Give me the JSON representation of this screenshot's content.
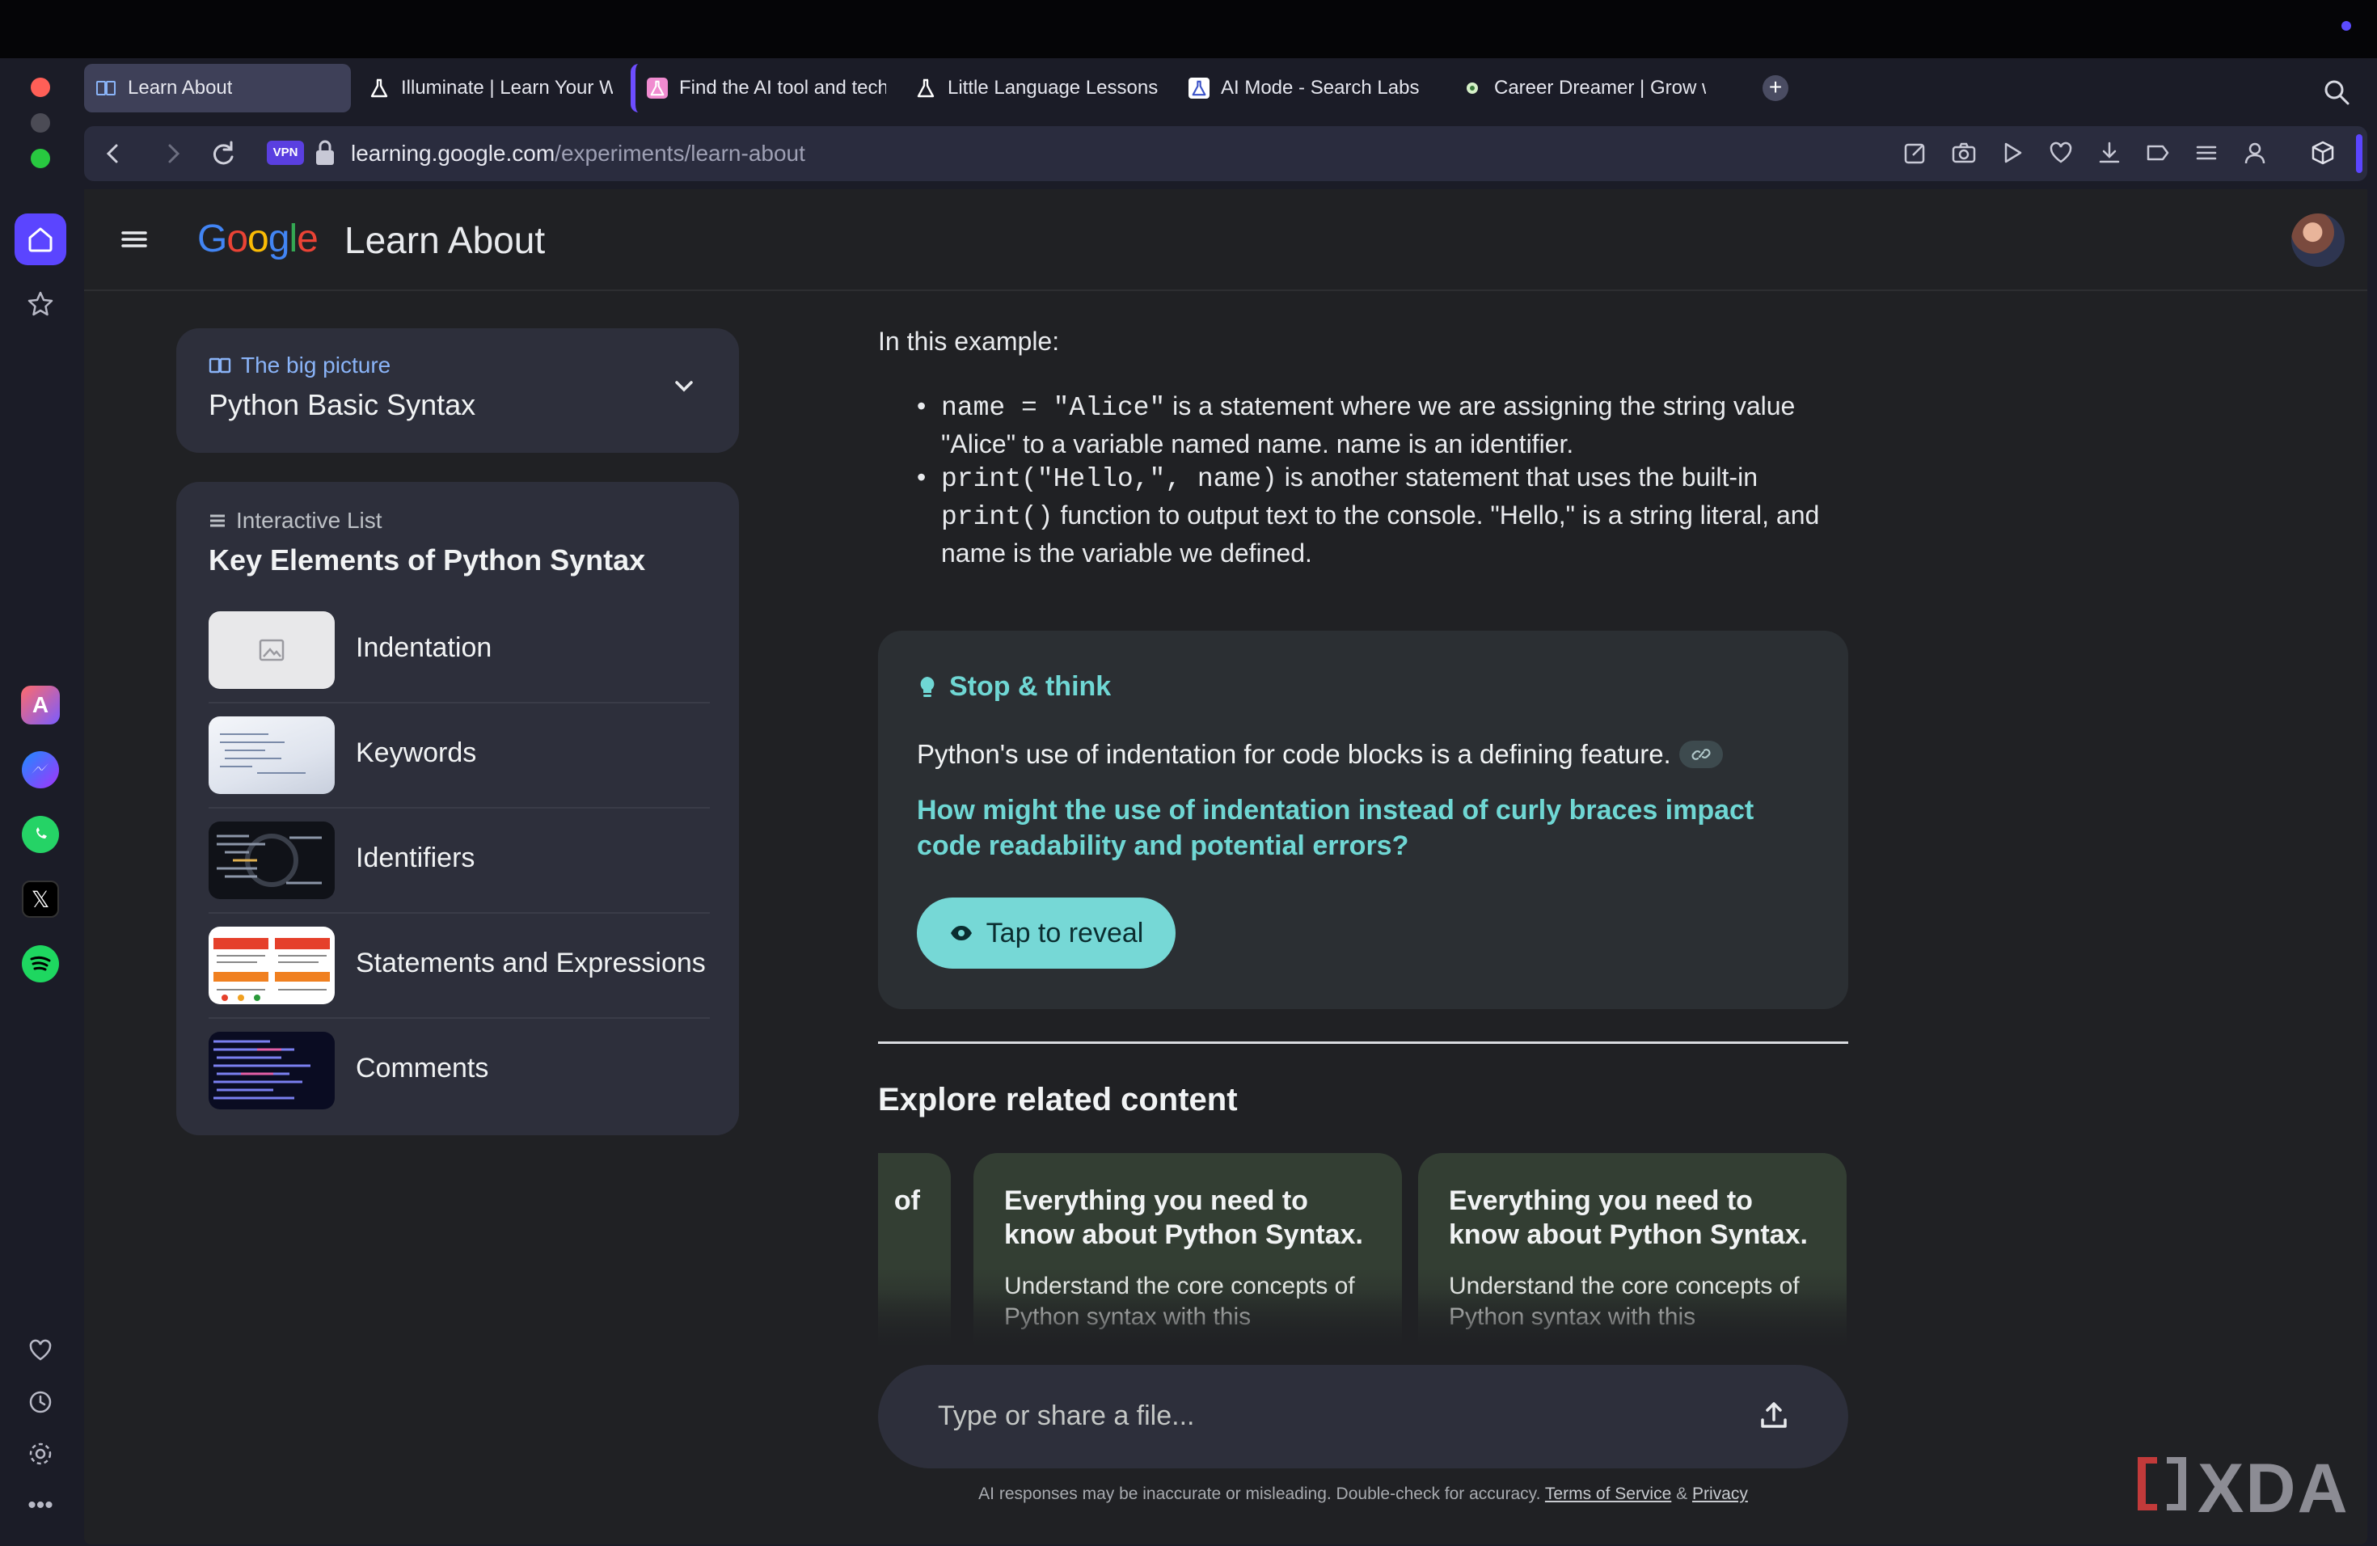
{
  "browser": {
    "tabs": [
      {
        "label": "Learn About",
        "icon": "book-icon",
        "active": true
      },
      {
        "label": "Illuminate | Learn Your W",
        "icon": "flask-icon",
        "active": false
      },
      {
        "label": "Find the AI tool and tech",
        "icon": "flask-icon",
        "active": false
      },
      {
        "label": "Little Language Lessons",
        "icon": "flask-icon",
        "active": false
      },
      {
        "label": "AI Mode - Search Labs",
        "icon": "flask-icon",
        "active": false
      },
      {
        "label": "Career Dreamer | Grow w",
        "icon": "dot-icon",
        "active": false
      }
    ],
    "vpn_label": "VPN",
    "url_host": "learning.google.com",
    "url_path": "/experiments/learn-about"
  },
  "app": {
    "logo": "Google",
    "title": "Learn About"
  },
  "big_picture": {
    "kicker": "The big picture",
    "title": "Python Basic Syntax"
  },
  "interactive_list": {
    "kicker": "Interactive List",
    "title": "Key Elements of Python Syntax",
    "items": [
      {
        "label": "Indentation"
      },
      {
        "label": "Keywords"
      },
      {
        "label": "Identifiers"
      },
      {
        "label": "Statements and Expressions"
      },
      {
        "label": "Comments"
      }
    ]
  },
  "content": {
    "intro": "In this example:",
    "b1_code1": "name = \"Alice\"",
    "b1_t1": " is a statement where we are assigning the string value \"Alice\" to a variable named ",
    "b1_code2": "name",
    "b1_t2": ". ",
    "b1_code3": "name",
    "b1_t3": " is an identifier.",
    "b2_code1": "print(\"Hello,\", name)",
    "b2_t1": " is another statement that uses the built-in ",
    "b2_code2": "print()",
    "b2_t2": " function to output text to the console. \"Hello,\" is a string literal, and ",
    "b2_code3": "name",
    "b2_t3": " is the variable we defined."
  },
  "stop_think": {
    "kicker": "Stop & think",
    "text": "Python's use of indentation for code blocks is a defining feature.",
    "question": "How might the use of indentation instead of curly braces impact code readability and potential errors?",
    "button": "Tap to reveal"
  },
  "related": {
    "heading": "Explore related content",
    "partial_text": "of",
    "cards": [
      {
        "title": "Everything you need to know about Python Syntax.",
        "desc": "Understand the core concepts of Python syntax with this"
      },
      {
        "title": "Everything you need to know about Python Syntax.",
        "desc": "Understand the core concepts of Python syntax with this"
      }
    ]
  },
  "chat": {
    "placeholder": "Type or share a file..."
  },
  "disclaimer": {
    "text": "AI responses may be inaccurate or misleading. Double-check for accuracy. ",
    "terms": "Terms of Service",
    "amp": " & ",
    "privacy": "Privacy"
  },
  "watermark": "XDA",
  "colors": {
    "accent_teal": "#76d8d6",
    "browser_accent": "#5b45ff",
    "link_blue": "#8ab4f8"
  }
}
